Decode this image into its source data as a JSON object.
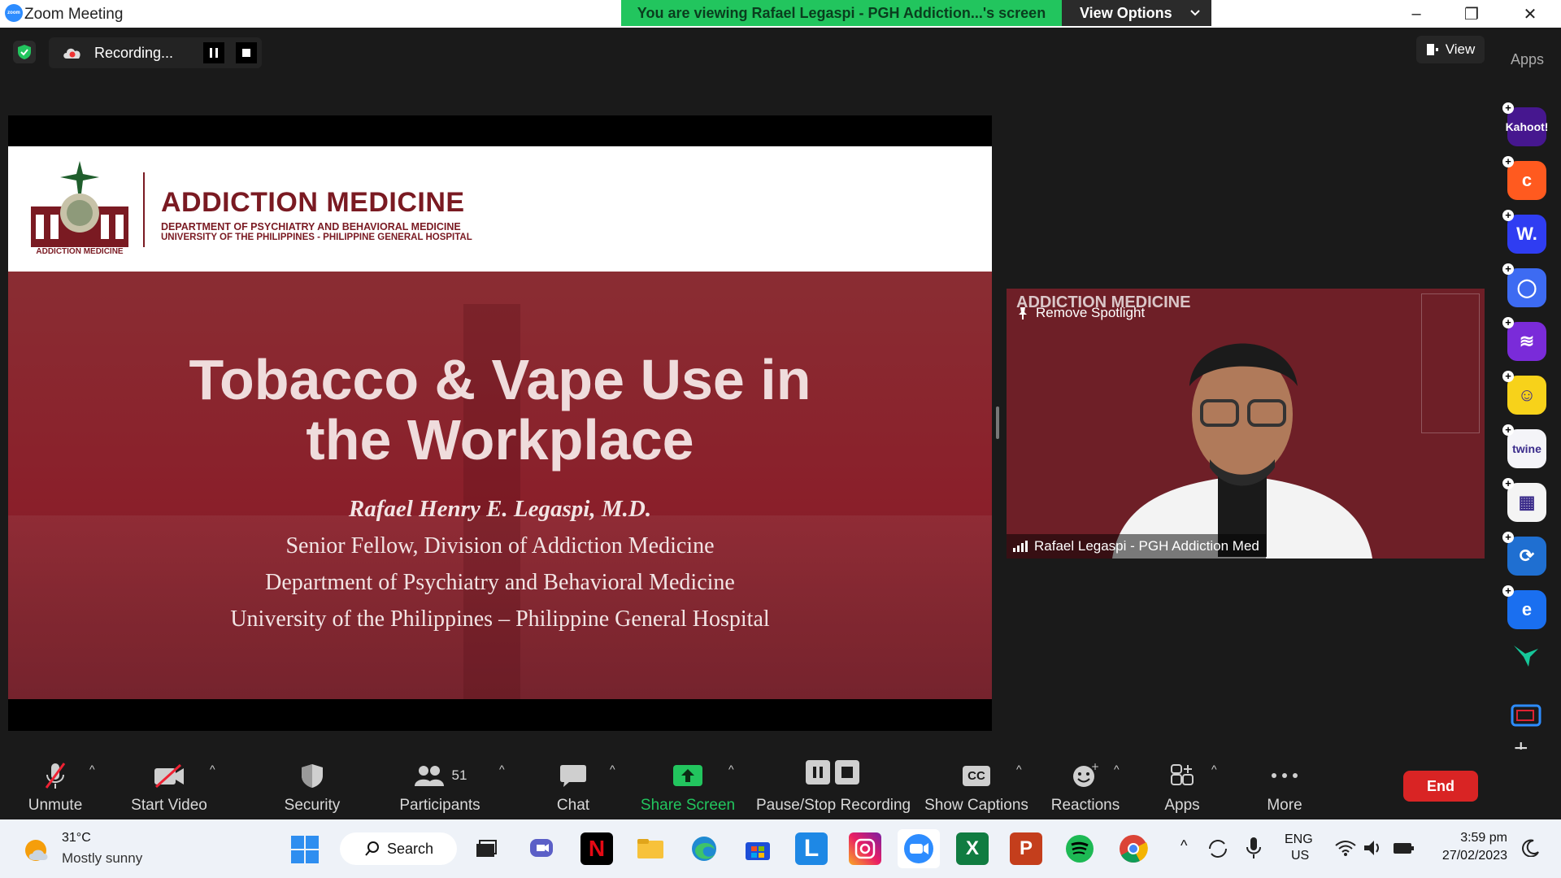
{
  "window": {
    "app_title": "Zoom Meeting",
    "minimize": "–",
    "restore": "❐",
    "close": "✕"
  },
  "banner": {
    "viewing_text": "You are viewing Rafael Legaspi - PGH Addiction...'s screen",
    "view_options": "View Options"
  },
  "topbar": {
    "recording_text": "Recording...",
    "view_label": "View",
    "apps_label": "Apps"
  },
  "slide": {
    "header_title": "ADDICTION MEDICINE",
    "header_dept": "DEPARTMENT OF PSYCHIATRY AND BEHAVIORAL MEDICINE",
    "header_univ": "UNIVERSITY OF THE PHILIPPINES - PHILIPPINE GENERAL HOSPITAL",
    "logo_text": "ADDICTION MEDICINE",
    "title_line1": "Tobacco & Vape Use in",
    "title_line2": "the Workplace",
    "presenter": "Rafael Henry E. Legaspi, M.D.",
    "line1": "Senior Fellow, Division of Addiction Medicine",
    "line2": "Department of Psychiatry and Behavioral Medicine",
    "line3": "University of the Philippines – Philippine General Hospital"
  },
  "video": {
    "bg_text": "ADDICTION MEDICINE",
    "remove_spotlight": "Remove Spotlight",
    "participant_name": "Rafael Legaspi - PGH Addiction Med"
  },
  "apps": [
    {
      "name": "Kahoot!",
      "label": "Kahoot!",
      "color": "#46178f"
    },
    {
      "name": "c-app",
      "label": "c",
      "color": "#ff5a1f"
    },
    {
      "name": "W-app",
      "label": "W.",
      "color": "#2f3df2"
    },
    {
      "name": "circle-app",
      "label": "◯",
      "color": "#3d6bf2"
    },
    {
      "name": "wave-app",
      "label": "≋",
      "color": "#7a2bd9"
    },
    {
      "name": "emoji-app",
      "label": "☺",
      "color": "#f7d21a"
    },
    {
      "name": "twine",
      "label": "twine",
      "color": "#f4f4f8"
    },
    {
      "name": "blocks-app",
      "label": "▦",
      "color": "#f4f4f4"
    },
    {
      "name": "sync-app",
      "label": "⟳",
      "color": "#1f6fd1"
    },
    {
      "name": "e-app",
      "label": "e",
      "color": "#1a6ff0"
    }
  ],
  "toolbar": {
    "unmute": "Unmute",
    "start_video": "Start Video",
    "security": "Security",
    "participants": "Participants",
    "participants_count": "51",
    "chat": "Chat",
    "share_screen": "Share Screen",
    "pause_stop": "Pause/Stop Recording",
    "captions": "Show Captions",
    "cc": "CC",
    "reactions": "Reactions",
    "apps": "Apps",
    "more": "More",
    "end": "End"
  },
  "taskbar": {
    "temperature": "31°C",
    "weather": "Mostly sunny",
    "search": "Search",
    "lang1": "ENG",
    "lang2": "US",
    "time": "3:59 pm",
    "date": "27/02/2023"
  },
  "colors": {
    "accent_green": "#22c55e",
    "end_red": "#d92424",
    "zoom_blue": "#2d8cff",
    "slide_red": "#8a1f2a"
  }
}
